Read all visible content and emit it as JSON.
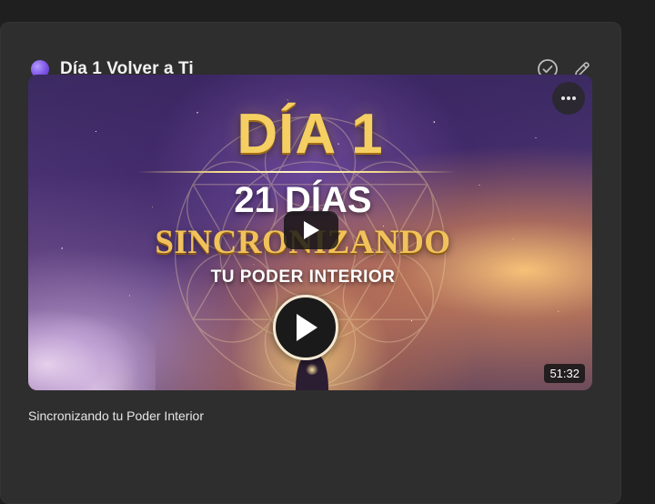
{
  "card": {
    "title": "Día 1 Volver a Ti",
    "accent_color": "#7c54e6",
    "actions": [
      {
        "icon": "check-circle-icon"
      },
      {
        "icon": "pencil-icon"
      }
    ]
  },
  "video": {
    "thumbnail_text": {
      "line1": "DÍA 1",
      "line2": "21 DÍAS",
      "line3": "SINCRONIZANDO",
      "line4": "TU PODER INTERIOR"
    },
    "duration": "51:32",
    "more_icon": "ellipsis-icon",
    "play_icon": "play-icon"
  },
  "caption": "Sincronizando tu Poder Interior"
}
